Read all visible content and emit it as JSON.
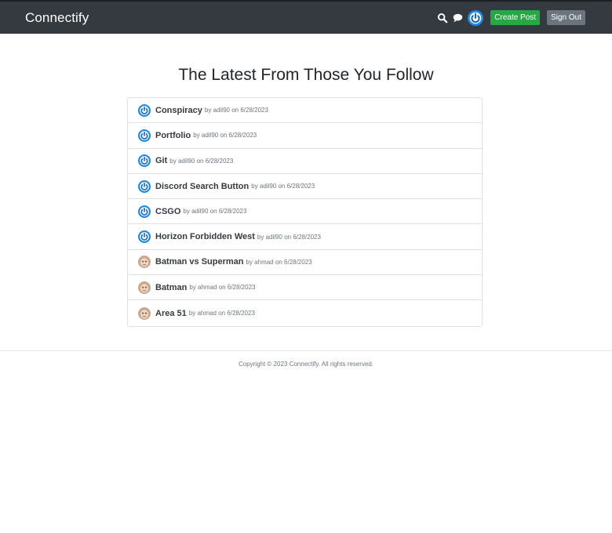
{
  "header": {
    "brand": "Connectify",
    "create_post_label": "Create Post",
    "sign_out_label": "Sign Out",
    "icons": [
      "search-icon",
      "chat-icon",
      "user-avatar"
    ],
    "colors": {
      "bar": "#343a40",
      "create": "#28a745",
      "sign_out": "#6c757d"
    }
  },
  "main": {
    "title": "The Latest From Those You Follow",
    "posts": [
      {
        "title": "Conspiracy",
        "by": "by",
        "author": "adil90",
        "on": "on",
        "date": "6/28/2023",
        "avatar": "power-avatar"
      },
      {
        "title": "Portfolio",
        "by": "by",
        "author": "adil90",
        "on": "on",
        "date": "6/28/2023",
        "avatar": "power-avatar"
      },
      {
        "title": "Git",
        "by": "by",
        "author": "adil90",
        "on": "on",
        "date": "6/28/2023",
        "avatar": "power-avatar"
      },
      {
        "title": "Discord Search Button",
        "by": "by",
        "author": "adil90",
        "on": "on",
        "date": "6/28/2023",
        "avatar": "power-avatar"
      },
      {
        "title": "CSGO",
        "by": "by",
        "author": "adil90",
        "on": "on",
        "date": "6/28/2023",
        "avatar": "power-avatar"
      },
      {
        "title": "Horizon Forbidden West",
        "by": "by",
        "author": "adil90",
        "on": "on",
        "date": "6/28/2023",
        "avatar": "power-avatar"
      },
      {
        "title": "Batman vs Superman",
        "by": "by",
        "author": "ahmad",
        "on": "on",
        "date": "6/28/2023",
        "avatar": "face-avatar"
      },
      {
        "title": "Batman",
        "by": "by",
        "author": "ahmad",
        "on": "on",
        "date": "6/28/2023",
        "avatar": "face-avatar"
      },
      {
        "title": "Area 51",
        "by": "by",
        "author": "ahmad",
        "on": "on",
        "date": "6/28/2023",
        "avatar": "face-avatar"
      }
    ]
  },
  "footer": {
    "copyright": "Copyright © 2023 Connectify. All rights reserved."
  }
}
